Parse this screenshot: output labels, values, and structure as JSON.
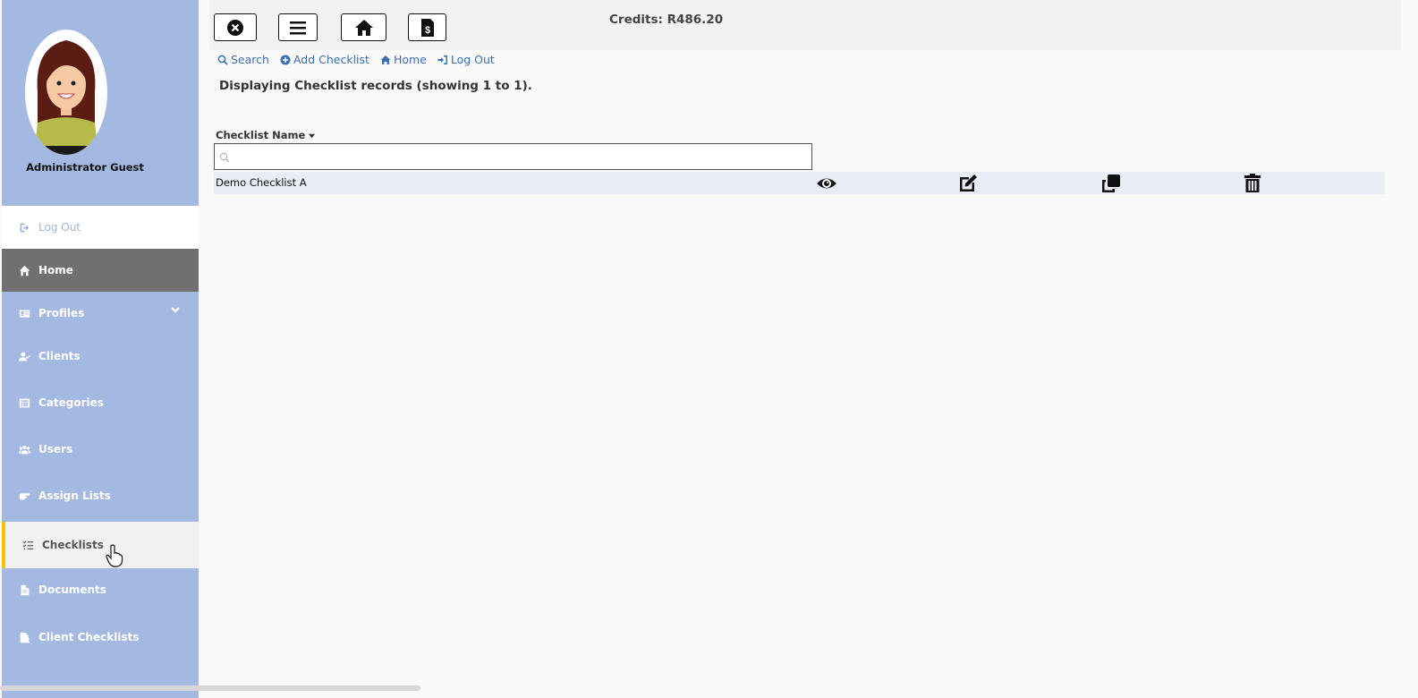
{
  "user": {
    "name": "Administrator Guest"
  },
  "sidebar": {
    "logout_label": "Log Out",
    "items": [
      {
        "label": "Home",
        "icon": "home-icon"
      },
      {
        "label": "Profiles",
        "icon": "id-card-icon"
      },
      {
        "label": "Clients",
        "icon": "user-check-icon"
      },
      {
        "label": "Categories",
        "icon": "list-alt-icon"
      },
      {
        "label": "Users",
        "icon": "users-icon"
      },
      {
        "label": "Assign Lists",
        "icon": "hand-pointing-icon"
      },
      {
        "label": "Checklists",
        "icon": "tasks-icon"
      },
      {
        "label": "Documents",
        "icon": "file-icon"
      },
      {
        "label": "Client Checklists",
        "icon": "file-user-icon"
      }
    ]
  },
  "topbar": {
    "credits": "Credits: R486.20",
    "buttons": [
      "close-icon",
      "menu-icon",
      "home-icon",
      "invoice-icon"
    ]
  },
  "links": {
    "search": "Search",
    "add_checklist": "Add Checklist",
    "home": "Home",
    "logout": "Log Out"
  },
  "heading": "Displaying Checklist records (showing 1 to 1).",
  "table": {
    "column_header": "Checklist Name",
    "search_placeholder": "",
    "rows": [
      {
        "name": "Demo Checklist A"
      }
    ],
    "actions": [
      "view-icon",
      "edit-icon",
      "copy-icon",
      "delete-icon"
    ]
  },
  "colors": {
    "sidebar_bg": "#a3b9e2",
    "active_accent": "#f5c000",
    "link": "#3a6fb0",
    "home_bg": "#707070"
  }
}
